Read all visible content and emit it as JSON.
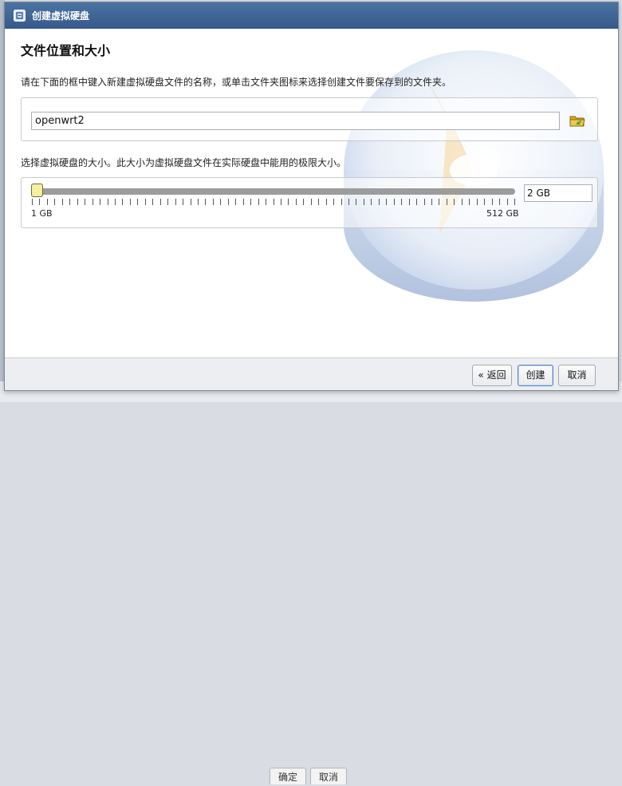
{
  "dialog": {
    "title": "创建虚拟硬盘",
    "heading": "文件位置和大小",
    "instruction": "请在下面的框中键入新建虚拟硬盘文件的名称，或单击文件夹图标来选择创建文件要保存到的文件夹。",
    "file_location": {
      "value": "openwrt2",
      "folder_icon": "folder-browse-icon"
    },
    "size_label": "选择虚拟硬盘的大小。此大小为虚拟硬盘文件在实际硬盘中能用的极限大小。",
    "size": {
      "value": "2 GB",
      "min_label": "1 GB",
      "max_label": "512 GB",
      "slider_fraction": 0.0,
      "tick_count": 65
    },
    "buttons": {
      "back": "« 返回",
      "create": "创建",
      "cancel": "取消"
    }
  },
  "background": {
    "buttons": [
      "确定",
      "取消"
    ]
  },
  "colors": {
    "titlebar": "#3f6594",
    "slider_thumb": "#f4f0a0",
    "default_button_border": "#5c86c2"
  }
}
